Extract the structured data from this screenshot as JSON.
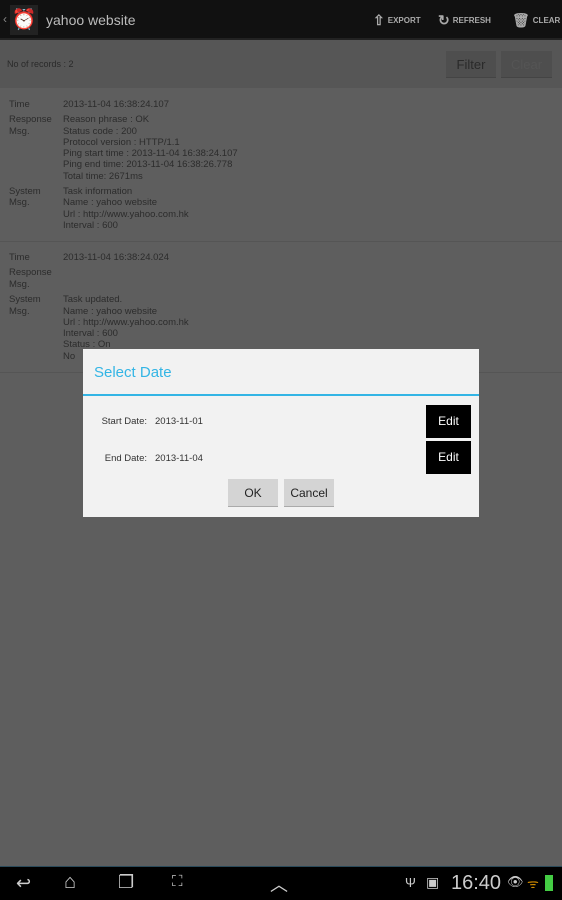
{
  "action_bar": {
    "title": "yahoo website",
    "export": "EXPORT",
    "refresh": "REFRESH",
    "clear": "CLEAR"
  },
  "records_bar": {
    "count": "No of records : 2",
    "filter": "Filter",
    "clear": "Clear"
  },
  "records": [
    {
      "time_label": "Time",
      "time": "2013-11-04 16:38:24.107",
      "response_label": "Response Msg.",
      "response": [
        "Reason phrase : OK",
        "Status code : 200",
        "Protocol version : HTTP/1.1",
        "Ping start time : 2013-11-04 16:38:24.107",
        "Ping end time: 2013-11-04 16:38:26.778",
        "Total time: 2671ms"
      ],
      "system_label": "System Msg.",
      "system": [
        "Task information",
        "Name : yahoo website",
        "Url : http://www.yahoo.com.hk",
        "Interval : 600"
      ]
    },
    {
      "time_label": "Time",
      "time": "2013-11-04 16:38:24.024",
      "response_label": "Response Msg.",
      "response": [],
      "system_label": "System Msg.",
      "system": [
        "Task updated.",
        "Name : yahoo website",
        "Url : http://www.yahoo.com.hk",
        "Interval : 600",
        "Status : On",
        "No"
      ]
    }
  ],
  "dialog": {
    "title": "Select Date",
    "start_label": "Start Date:",
    "start_value": "2013-11-01",
    "end_label": "End Date:",
    "end_value": "2013-11-04",
    "edit": "Edit",
    "ok": "OK",
    "cancel": "Cancel"
  },
  "status_bar": {
    "time": "16:40"
  },
  "colors": {
    "accent": "#33b5e5"
  }
}
